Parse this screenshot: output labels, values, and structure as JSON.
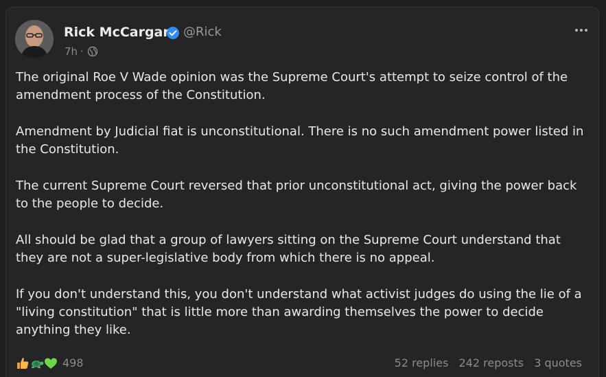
{
  "post": {
    "author_name": "Rick McCargar",
    "handle": "@Rick",
    "time": "7h",
    "separator": "·",
    "verified": true,
    "paragraphs": [
      "The original Roe V Wade opinion was the Supreme Court's attempt to seize control of the\namendment process of the Constitution.",
      "Amendment by Judicial fiat is unconstitutional. There is no such amendment power listed in\nthe Constitution.",
      "The current Supreme Court reversed that prior unconstitutional act, giving the power back\nto the people to decide.",
      "All should be glad that a group of lawyers sitting on the Supreme Court understand that\nthey are not a super-legislative body from which there is no appeal.",
      "If you don't understand this, you don't understand what activist judges do using the lie of a\n\"living constitution\" that is little more than awarding themselves the power to decide\nanything they like."
    ],
    "reactions": {
      "icons": [
        "thumbs-up-icon",
        "turtle-icon",
        "green-heart-icon"
      ],
      "count": "498"
    },
    "stats": {
      "replies": "52 replies",
      "reposts": "242 reposts",
      "quotes": "3 quotes"
    }
  },
  "colors": {
    "background": "#1e1e1e",
    "card": "#252525",
    "text": "#e9e9e9",
    "muted": "#8c8c8c",
    "verified": "#2f8cf0"
  }
}
